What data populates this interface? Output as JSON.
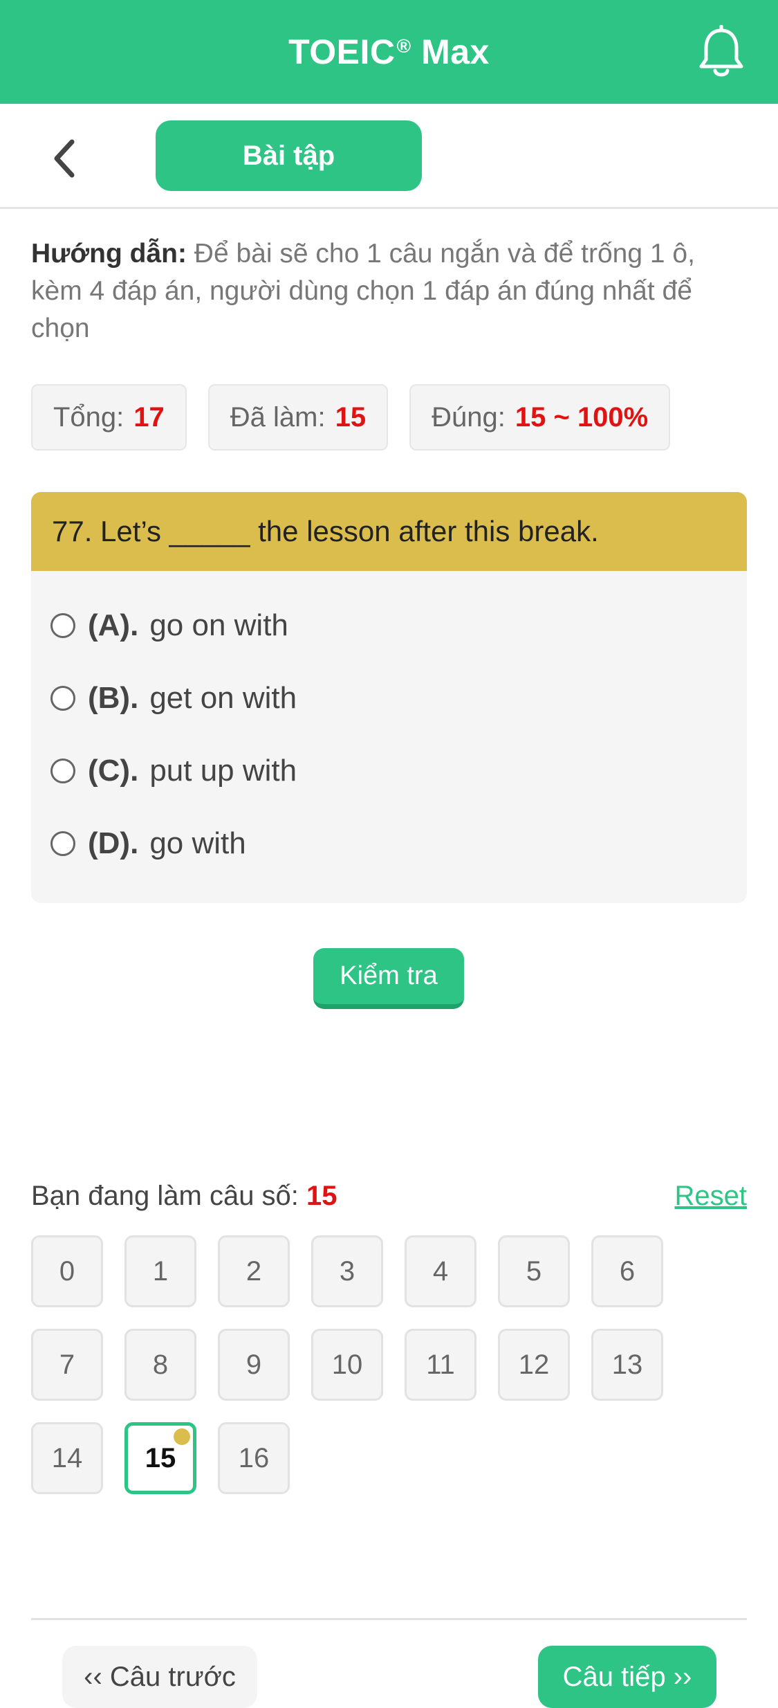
{
  "header": {
    "title": "TOEIC",
    "title_mark": "®",
    "title_suffix": "Max",
    "icon": "bell-icon"
  },
  "subheader": {
    "back_icon": "chevron-left-icon",
    "tab_label": "Bài tập"
  },
  "instructions": {
    "label": "Hướng dẫn:",
    "text": "Để bài sẽ cho 1 câu ngắn và để trống 1 ô, kèm 4 đáp án, người dùng chọn 1 đáp án đúng nhất để chọn"
  },
  "stats": {
    "total_label": "Tổng:",
    "total_value": "17",
    "done_label": "Đã làm:",
    "done_value": "15",
    "correct_label": "Đúng:",
    "correct_value": "15 ~ 100%"
  },
  "question": {
    "text": "77. Let’s _____ the lesson after this break.",
    "options": [
      {
        "letter": "(A).",
        "text": "go on with"
      },
      {
        "letter": "(B).",
        "text": "get on with"
      },
      {
        "letter": "(C).",
        "text": "put up with"
      },
      {
        "letter": "(D).",
        "text": "go with"
      }
    ]
  },
  "check_button": "Kiểm tra",
  "progress": {
    "label": "Bạn đang làm câu số:",
    "current": "15",
    "reset": "Reset",
    "numbers": [
      "0",
      "1",
      "2",
      "3",
      "4",
      "5",
      "6",
      "7",
      "8",
      "9",
      "10",
      "11",
      "12",
      "13",
      "14",
      "15",
      "16"
    ],
    "current_index": 15
  },
  "nav": {
    "prev": "‹‹ Câu trước",
    "next": "Câu tiếp ››"
  },
  "colors": {
    "brand": "#2ec486",
    "question_header": "#dbbd4e",
    "highlight_number": "#e01313"
  }
}
